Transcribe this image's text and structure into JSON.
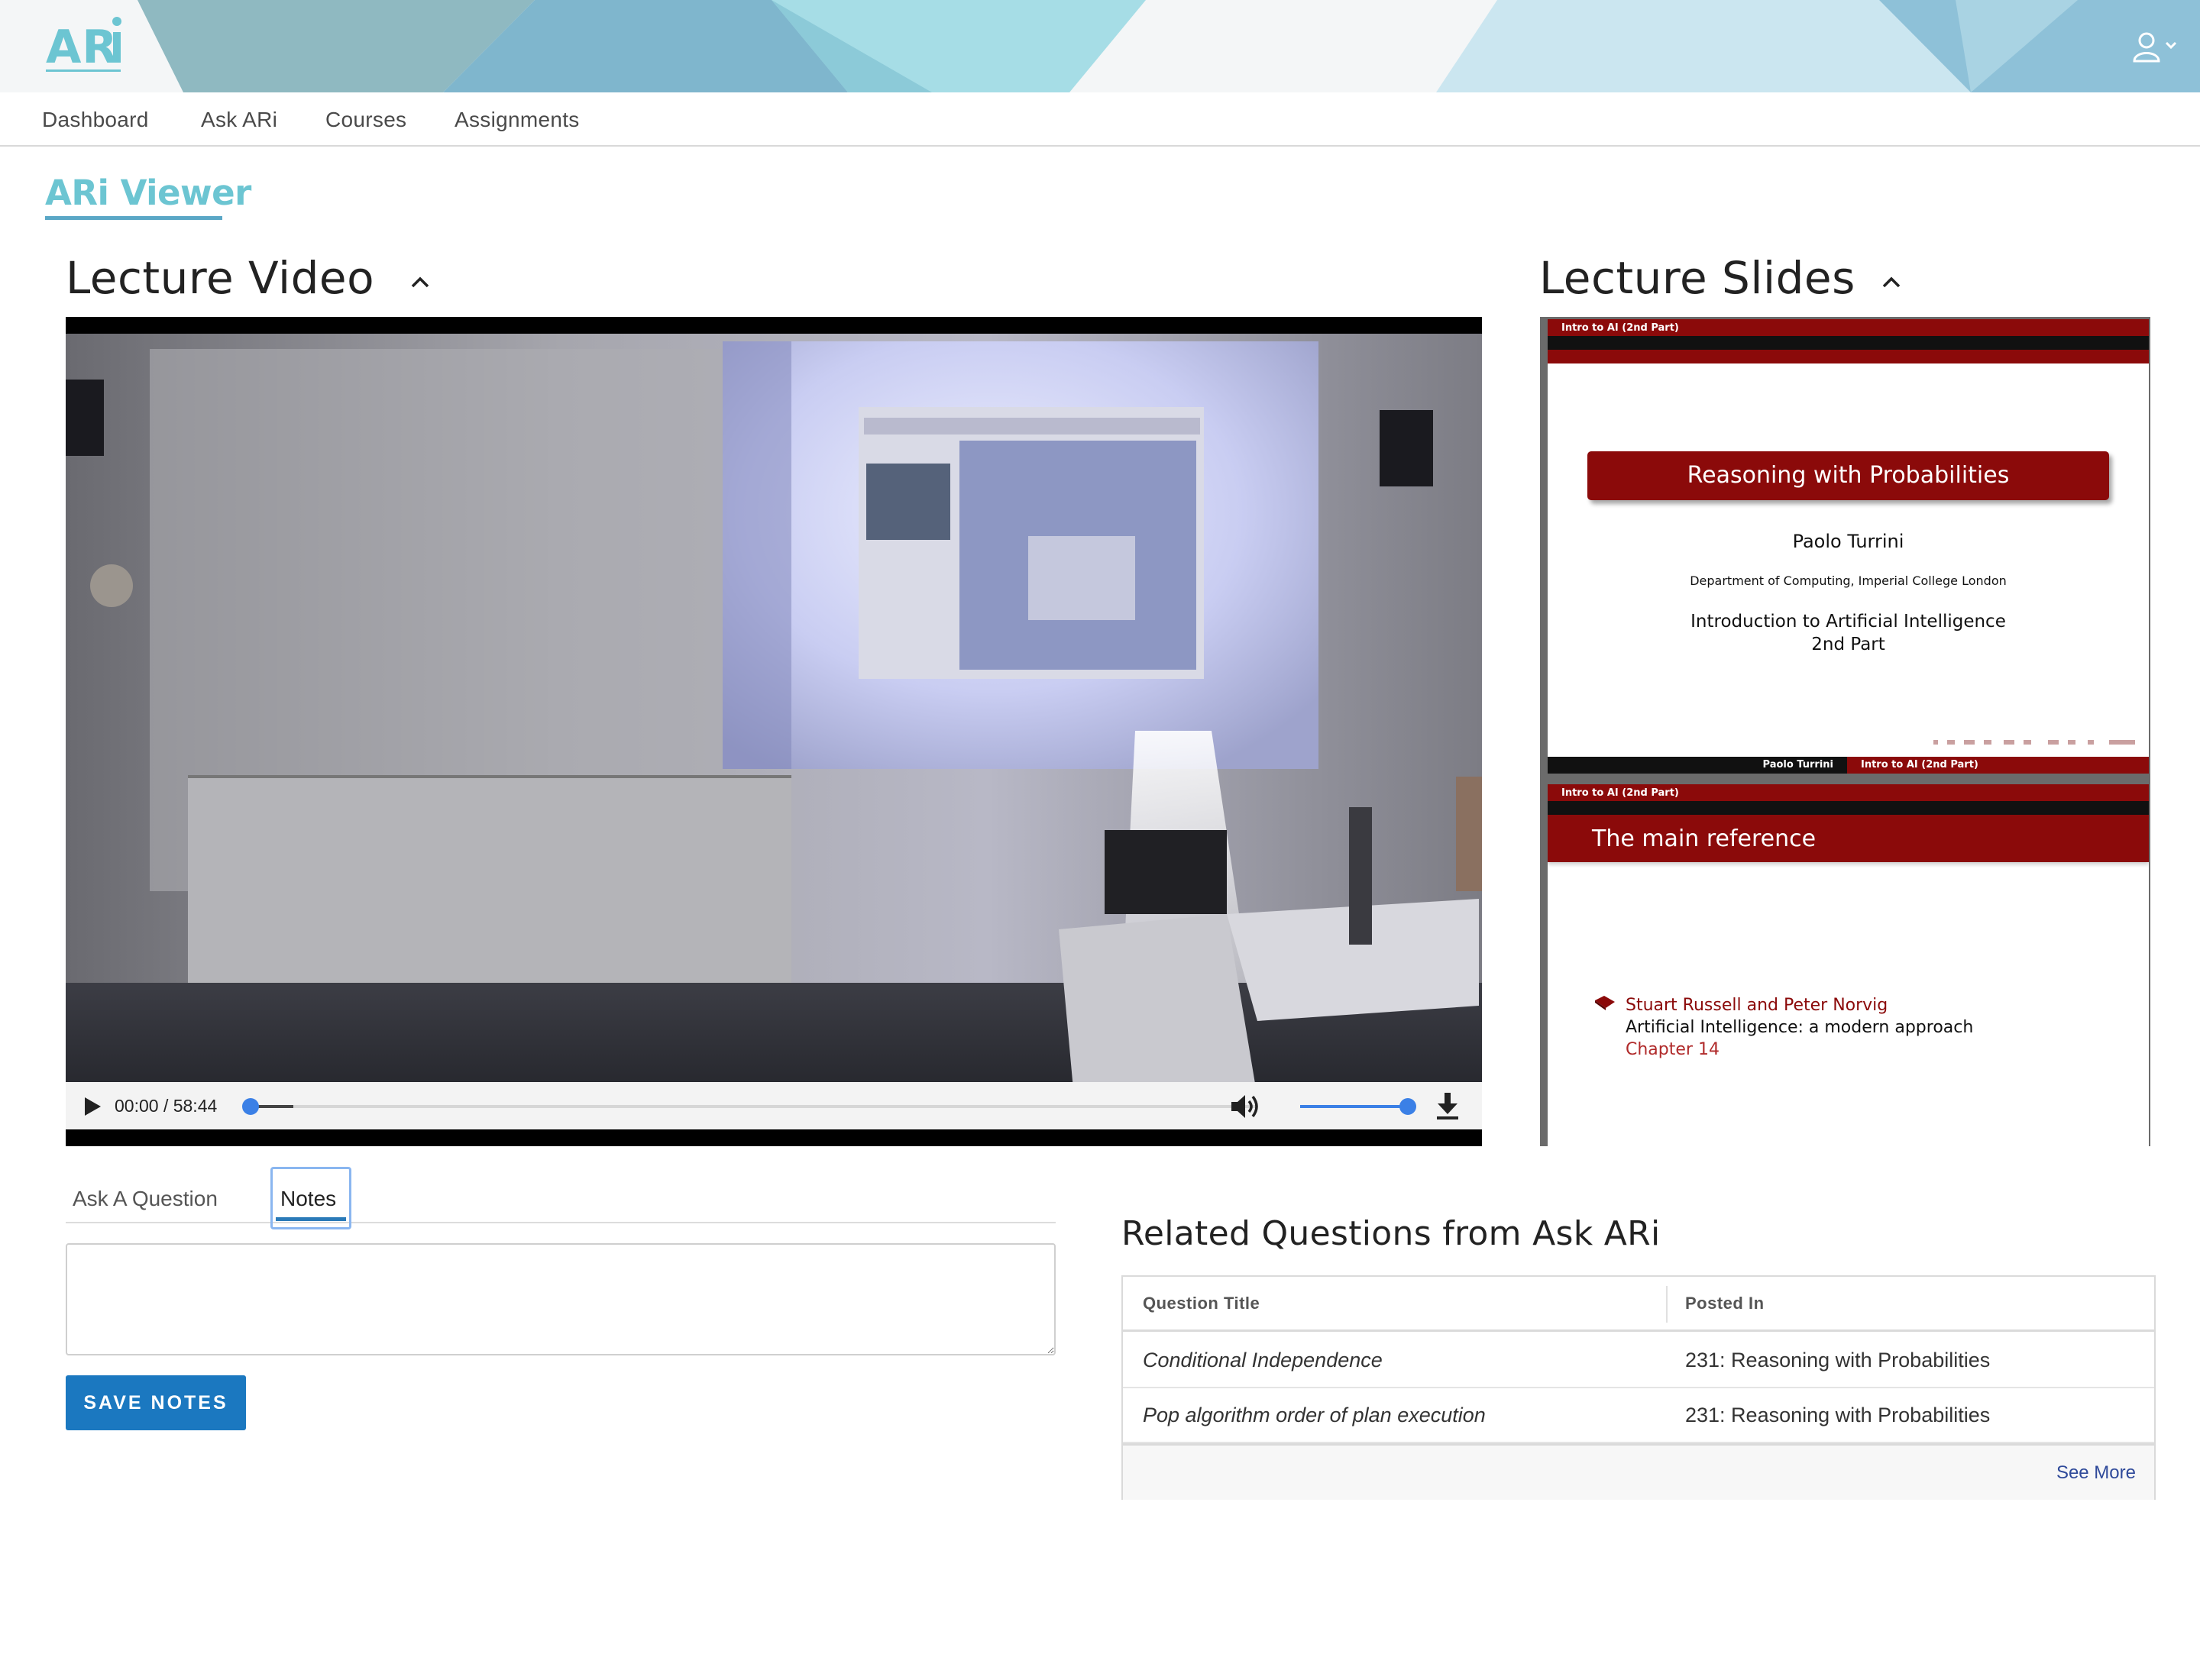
{
  "app": {
    "logo_text": "ARi",
    "accent": "#6cc5d2",
    "brand_blue": "#1b78c0",
    "slide_red": "#8b0a0a"
  },
  "nav": {
    "items": [
      {
        "label": "Dashboard"
      },
      {
        "label": "Ask ARi"
      },
      {
        "label": "Courses"
      },
      {
        "label": "Assignments"
      }
    ]
  },
  "page": {
    "title": "ARi Viewer"
  },
  "video": {
    "heading": "Lecture Video",
    "time_display": "00:00 / 58:44",
    "progress_fraction": 0.0,
    "volume_fraction": 1.0
  },
  "slides": {
    "heading": "Lecture Slides",
    "slide1": {
      "header": "Intro to AI (2nd Part)",
      "title": "Reasoning with Probabilities",
      "author": "Paolo Turrini",
      "department": "Department of Computing, Imperial College London",
      "course_line1": "Introduction to Artificial Intelligence",
      "course_line2": "2nd Part",
      "footer_left": "Paolo Turrini",
      "footer_right": "Intro to AI (2nd Part)"
    },
    "slide2": {
      "header": "Intro to AI (2nd Part)",
      "title": "The main reference",
      "authors": "Stuart Russell and Peter Norvig",
      "book": "Artificial Intelligence: a modern approach",
      "chapter": "Chapter 14"
    }
  },
  "tabs": {
    "items": [
      {
        "label": "Ask A Question",
        "active": false
      },
      {
        "label": "Notes",
        "active": true
      }
    ]
  },
  "notes": {
    "value": "",
    "save_label": "SAVE NOTES"
  },
  "related": {
    "title": "Related Questions from Ask ARi",
    "columns": [
      "Question Title",
      "Posted In"
    ],
    "rows": [
      {
        "title": "Conditional Independence",
        "posted_in": "231: Reasoning with Probabilities"
      },
      {
        "title": "Pop algorithm order of plan execution",
        "posted_in": "231: Reasoning with Probabilities"
      }
    ],
    "see_more": "See More"
  },
  "icons": {
    "user": "user-icon",
    "play": "play-icon",
    "volume": "volume-icon",
    "download": "download-icon",
    "collapse": "chevron-up-icon"
  }
}
